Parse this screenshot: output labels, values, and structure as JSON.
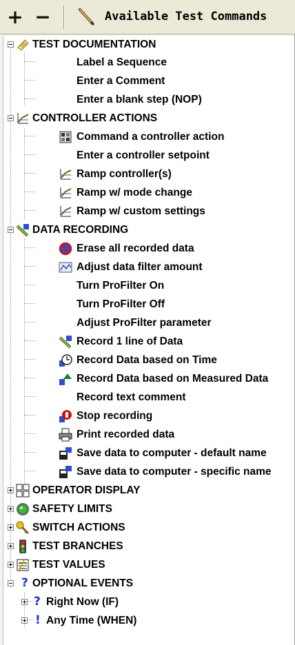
{
  "toolbar": {
    "add_label": "+",
    "remove_label": "−",
    "edit_icon": "pencil-icon",
    "title": "Available Test Commands"
  },
  "tree": {
    "test_documentation": {
      "label": "TEST DOCUMENTATION",
      "icon": "notepad-icon",
      "items": [
        "Label a Sequence",
        "Enter a Comment",
        "Enter a blank step (NOP)"
      ]
    },
    "controller_actions": {
      "label": "CONTROLLER ACTIONS",
      "icon": "chart-icon",
      "items": [
        "Command a controller action",
        "Enter a controller setpoint",
        "Ramp controller(s)",
        "Ramp w/ mode change",
        "Ramp w/ custom settings"
      ]
    },
    "data_recording": {
      "label": "DATA RECORDING",
      "icon": "recorder-icon",
      "items": [
        "Erase all recorded data",
        "Adjust data filter amount",
        "Turn ProFilter On",
        "Turn ProFilter Off",
        "Adjust ProFilter parameter",
        "Record 1 line of Data",
        "Record Data based on Time",
        "Record Data based on Measured Data",
        "Record text comment",
        "Stop recording",
        "Print recorded data",
        "Save data to computer - default name",
        "Save data to computer - specific name"
      ]
    },
    "collapsed": [
      "OPERATOR DISPLAY",
      "SAFETY LIMITS",
      "SWITCH ACTIONS",
      "TEST BRANCHES",
      "TEST VALUES"
    ],
    "optional_events": {
      "label": "OPTIONAL EVENTS",
      "items": [
        "Right Now (IF)",
        "Any Time (WHEN)"
      ]
    }
  },
  "colors": {
    "toolbar": "#ece9d8",
    "tree_bg": "#ffffff",
    "question": "#1a2fd0"
  }
}
